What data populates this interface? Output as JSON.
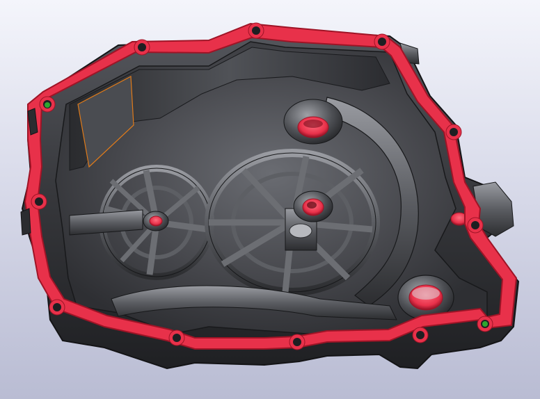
{
  "viewport": {
    "background_top": "#f4f5fb",
    "background_bottom": "#b9bcd3"
  },
  "model": {
    "part": "engine-side-cover-casting",
    "body_color": "#3a3b3f",
    "edge_color": "#141416",
    "highlight_color": "#8a8c92",
    "selected_face_color": "#e8314a",
    "selected_face_edge_color": "#9e1426",
    "highlighted_face_edge_color": "#e07b1a",
    "hole_marker_color": "#2fa62f"
  }
}
